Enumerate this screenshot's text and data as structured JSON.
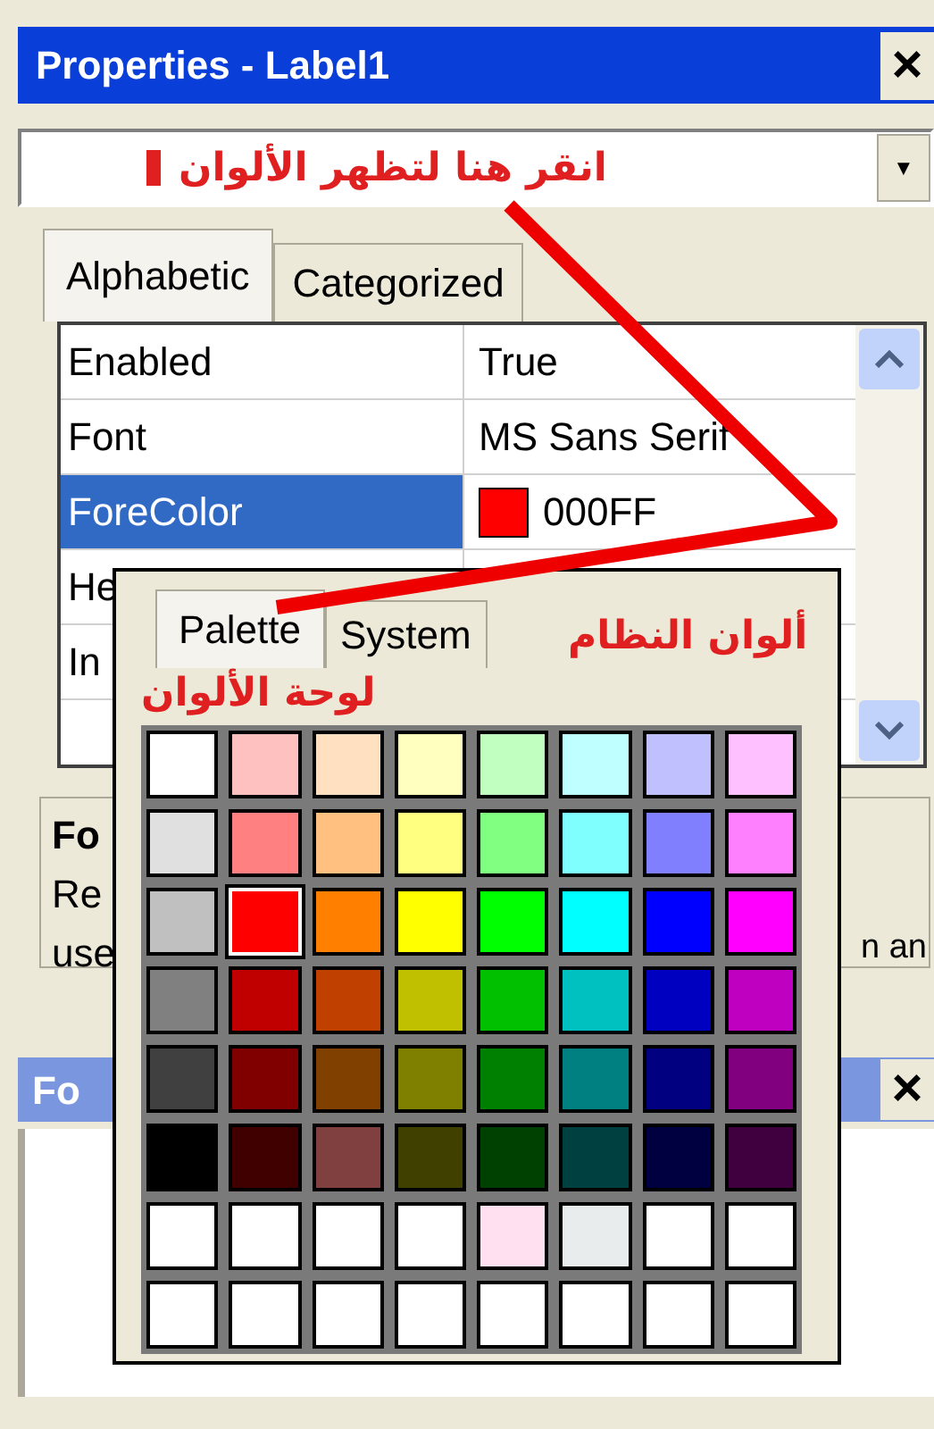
{
  "window": {
    "title": "Properties - Label1",
    "close": "×"
  },
  "object_combo": {
    "annotation": "انقر هنا لتظهر الألوان",
    "caret": "▼"
  },
  "tabs": [
    {
      "label": "Alphabetic",
      "selected": true
    },
    {
      "label": "Categorized",
      "selected": false
    }
  ],
  "properties": [
    {
      "name": "Enabled",
      "value": "True",
      "selected": false
    },
    {
      "name": "Font",
      "value": "MS Sans Serif",
      "selected": false
    },
    {
      "name": "ForeColor",
      "value": "000FF",
      "color": "#ff0000",
      "selected": true
    },
    {
      "name": "He",
      "selected": false
    },
    {
      "name": "In",
      "selected": false
    }
  ],
  "description": {
    "title": "Fo",
    "line_1": "Re",
    "line_2_start": "use",
    "line_2_end": "n an"
  },
  "second_panel": {
    "title": "Fo",
    "close": "×"
  },
  "color_popup": {
    "tabs": [
      {
        "label": "Palette",
        "selected": true
      },
      {
        "label": "System",
        "selected": false
      }
    ],
    "annotations": [
      "ألوان النظام",
      "لوحة الألوان"
    ],
    "palette": [
      {
        "swatches": [
          {
            "color": "#ffffff",
            "selected": false
          },
          {
            "color": "#ffc0c0",
            "selected": false
          },
          {
            "color": "#ffe0c0",
            "selected": false
          },
          {
            "color": "#ffffc0",
            "selected": false
          },
          {
            "color": "#c0ffc0",
            "selected": false
          },
          {
            "color": "#c0ffff",
            "selected": false
          },
          {
            "color": "#c0c0ff",
            "selected": false
          },
          {
            "color": "#ffc0ff",
            "selected": false
          }
        ]
      },
      {
        "swatches": [
          {
            "color": "#e0e0e0",
            "selected": false
          },
          {
            "color": "#ff8080",
            "selected": false
          },
          {
            "color": "#ffc080",
            "selected": false
          },
          {
            "color": "#ffff80",
            "selected": false
          },
          {
            "color": "#80ff80",
            "selected": false
          },
          {
            "color": "#80ffff",
            "selected": false
          },
          {
            "color": "#8080ff",
            "selected": false
          },
          {
            "color": "#ff80ff",
            "selected": false
          }
        ]
      },
      {
        "swatches": [
          {
            "color": "#c0c0c0",
            "selected": false
          },
          {
            "color": "#ff0000",
            "selected": true
          },
          {
            "color": "#ff8000",
            "selected": false
          },
          {
            "color": "#ffff00",
            "selected": false
          },
          {
            "color": "#00ff00",
            "selected": false
          },
          {
            "color": "#00ffff",
            "selected": false
          },
          {
            "color": "#0000ff",
            "selected": false
          },
          {
            "color": "#ff00ff",
            "selected": false
          }
        ]
      },
      {
        "swatches": [
          {
            "color": "#808080",
            "selected": false
          },
          {
            "color": "#c00000",
            "selected": false
          },
          {
            "color": "#c04000",
            "selected": false
          },
          {
            "color": "#c0c000",
            "selected": false
          },
          {
            "color": "#00c000",
            "selected": false
          },
          {
            "color": "#00c0c0",
            "selected": false
          },
          {
            "color": "#0000c0",
            "selected": false
          },
          {
            "color": "#c000c0",
            "selected": false
          }
        ]
      },
      {
        "swatches": [
          {
            "color": "#404040",
            "selected": false
          },
          {
            "color": "#800000",
            "selected": false
          },
          {
            "color": "#804000",
            "selected": false
          },
          {
            "color": "#808000",
            "selected": false
          },
          {
            "color": "#008000",
            "selected": false
          },
          {
            "color": "#008080",
            "selected": false
          },
          {
            "color": "#000080",
            "selected": false
          },
          {
            "color": "#800080",
            "selected": false
          }
        ]
      },
      {
        "swatches": [
          {
            "color": "#000000",
            "selected": false
          },
          {
            "color": "#400000",
            "selected": false
          },
          {
            "color": "#804040",
            "selected": false
          },
          {
            "color": "#404000",
            "selected": false
          },
          {
            "color": "#004000",
            "selected": false
          },
          {
            "color": "#004040",
            "selected": false
          },
          {
            "color": "#000040",
            "selected": false
          },
          {
            "color": "#400040",
            "selected": false
          }
        ]
      },
      {
        "swatches": [
          {
            "color": "#ffffff",
            "selected": false
          },
          {
            "color": "#ffffff",
            "selected": false
          },
          {
            "color": "#ffffff",
            "selected": false
          },
          {
            "color": "#ffffff",
            "selected": false
          },
          {
            "color": "#ffe0f0",
            "selected": false
          },
          {
            "color": "#e8ecec",
            "selected": false
          },
          {
            "color": "#ffffff",
            "selected": false
          },
          {
            "color": "#ffffff",
            "selected": false
          }
        ]
      },
      {
        "swatches": [
          {
            "color": "#ffffff",
            "selected": false
          },
          {
            "color": "#ffffff",
            "selected": false
          },
          {
            "color": "#ffffff",
            "selected": false
          },
          {
            "color": "#ffffff",
            "selected": false
          },
          {
            "color": "#ffffff",
            "selected": false
          },
          {
            "color": "#ffffff",
            "selected": false
          },
          {
            "color": "#ffffff",
            "selected": false
          },
          {
            "color": "#ffffff",
            "selected": false
          }
        ]
      }
    ]
  }
}
